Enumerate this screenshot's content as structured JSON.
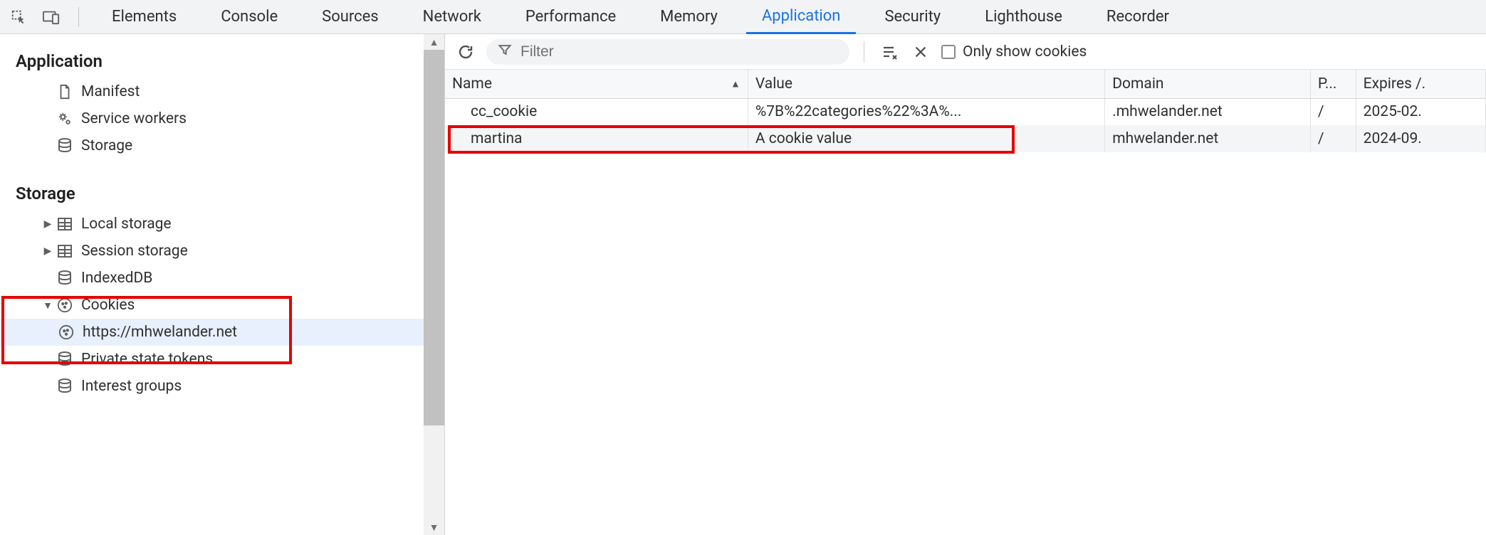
{
  "tabs": {
    "items": [
      {
        "label": "Elements"
      },
      {
        "label": "Console"
      },
      {
        "label": "Sources"
      },
      {
        "label": "Network"
      },
      {
        "label": "Performance"
      },
      {
        "label": "Memory"
      },
      {
        "label": "Application",
        "active": true
      },
      {
        "label": "Security"
      },
      {
        "label": "Lighthouse"
      },
      {
        "label": "Recorder"
      }
    ]
  },
  "sidebar": {
    "section_application": "Application",
    "section_storage": "Storage",
    "items_app": {
      "manifest": "Manifest",
      "service_workers": "Service workers",
      "storage": "Storage"
    },
    "items_storage": {
      "local_storage": "Local storage",
      "session_storage": "Session storage",
      "indexeddb": "IndexedDB",
      "cookies": "Cookies",
      "cookie_origin": "https://mhwelander.net",
      "private_state_tokens": "Private state tokens",
      "interest_groups": "Interest groups"
    }
  },
  "toolbar": {
    "filter_placeholder": "Filter",
    "only_show_cookies": "Only show cookies"
  },
  "cookies_table": {
    "columns": {
      "name": "Name",
      "value": "Value",
      "domain": "Domain",
      "path": "P...",
      "expires": "Expires /."
    },
    "rows": [
      {
        "name": "cc_cookie",
        "value": "%7B%22categories%22%3A%...",
        "domain": ".mhwelander.net",
        "path": "/",
        "expires": "2025-02."
      },
      {
        "name": "martina",
        "value": "A cookie value",
        "domain": "mhwelander.net",
        "path": "/",
        "expires": "2024-09."
      }
    ]
  }
}
